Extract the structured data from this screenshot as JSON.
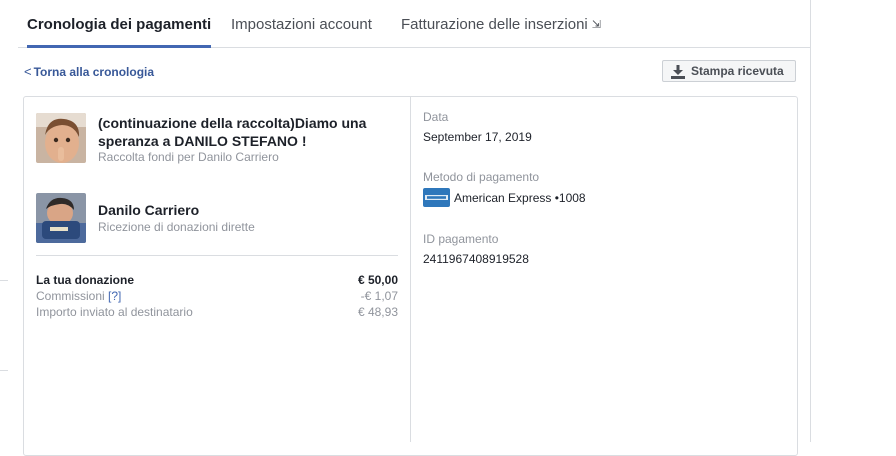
{
  "tabs": [
    {
      "label": "Cronologia dei pagamenti",
      "active": true
    },
    {
      "label": "Impostazioni account",
      "active": false
    },
    {
      "label": "Fatturazione delle inserzioni",
      "active": false
    }
  ],
  "back_link": "Torna alla cronologia",
  "print_button": "Stampa ricevuta",
  "fundraiser": {
    "title": "(continuazione della raccolta)Diamo una speranza a DANILO STEFANO !",
    "subtitle": "Raccolta fondi per Danilo Carriero"
  },
  "recipient": {
    "name": "Danilo Carriero",
    "subtitle": "Ricezione di donazioni dirette"
  },
  "summary": {
    "donation_label": "La tua donazione",
    "donation_value": "€ 50,00",
    "fees_label": "Commissioni",
    "fees_help": "[?]",
    "fees_value": "-€ 1,07",
    "sent_label": "Importo inviato al destinatario",
    "sent_value": "€ 48,93"
  },
  "details": {
    "date_label": "Data",
    "date_value": "September 17, 2019",
    "method_label": "Metodo di pagamento",
    "method_value": "American Express •1008",
    "id_label": "ID pagamento",
    "id_value": "2411967408919528"
  },
  "colors": {
    "accent": "#4267b2",
    "link": "#385898",
    "muted": "#90949c",
    "border": "#dadde1",
    "amex": "#2e77bb"
  },
  "icons": [
    "chevron-left-icon",
    "download-icon",
    "external-link-icon",
    "amex-card-icon"
  ]
}
